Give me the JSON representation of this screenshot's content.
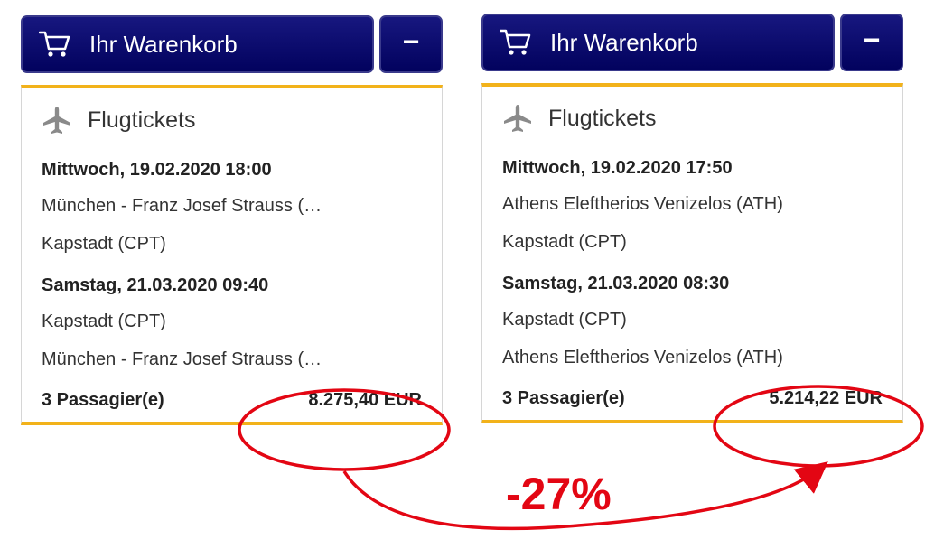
{
  "carts": [
    {
      "title": "Ihr Warenkorb",
      "collapse_label": "−",
      "section_title": "Flugtickets",
      "legs": [
        {
          "date": "Mittwoch, 19.02.2020 18:00",
          "from": "München - Franz Josef Strauss (…",
          "to": "Kapstadt (CPT)"
        },
        {
          "date": "Samstag, 21.03.2020 09:40",
          "from": "Kapstadt (CPT)",
          "to": "München - Franz Josef Strauss (…"
        }
      ],
      "passengers": "3 Passagier(e)",
      "price": "8.275,40 EUR"
    },
    {
      "title": "Ihr Warenkorb",
      "collapse_label": "−",
      "section_title": "Flugtickets",
      "legs": [
        {
          "date": "Mittwoch, 19.02.2020 17:50",
          "from": "Athens Eleftherios Venizelos (ATH)",
          "to": "Kapstadt (CPT)"
        },
        {
          "date": "Samstag, 21.03.2020 08:30",
          "from": "Kapstadt (CPT)",
          "to": "Athens Eleftherios Venizelos (ATH)"
        }
      ],
      "passengers": "3 Passagier(e)",
      "price": "5.214,22 EUR"
    }
  ],
  "annotation": {
    "discount": "-27%",
    "color": "#e30613"
  },
  "icons": {
    "cart": "shopping-cart-icon",
    "plane": "airplane-icon"
  },
  "colors": {
    "header_blue": "#0a0a6e",
    "accent_yellow": "#f2b21a"
  }
}
